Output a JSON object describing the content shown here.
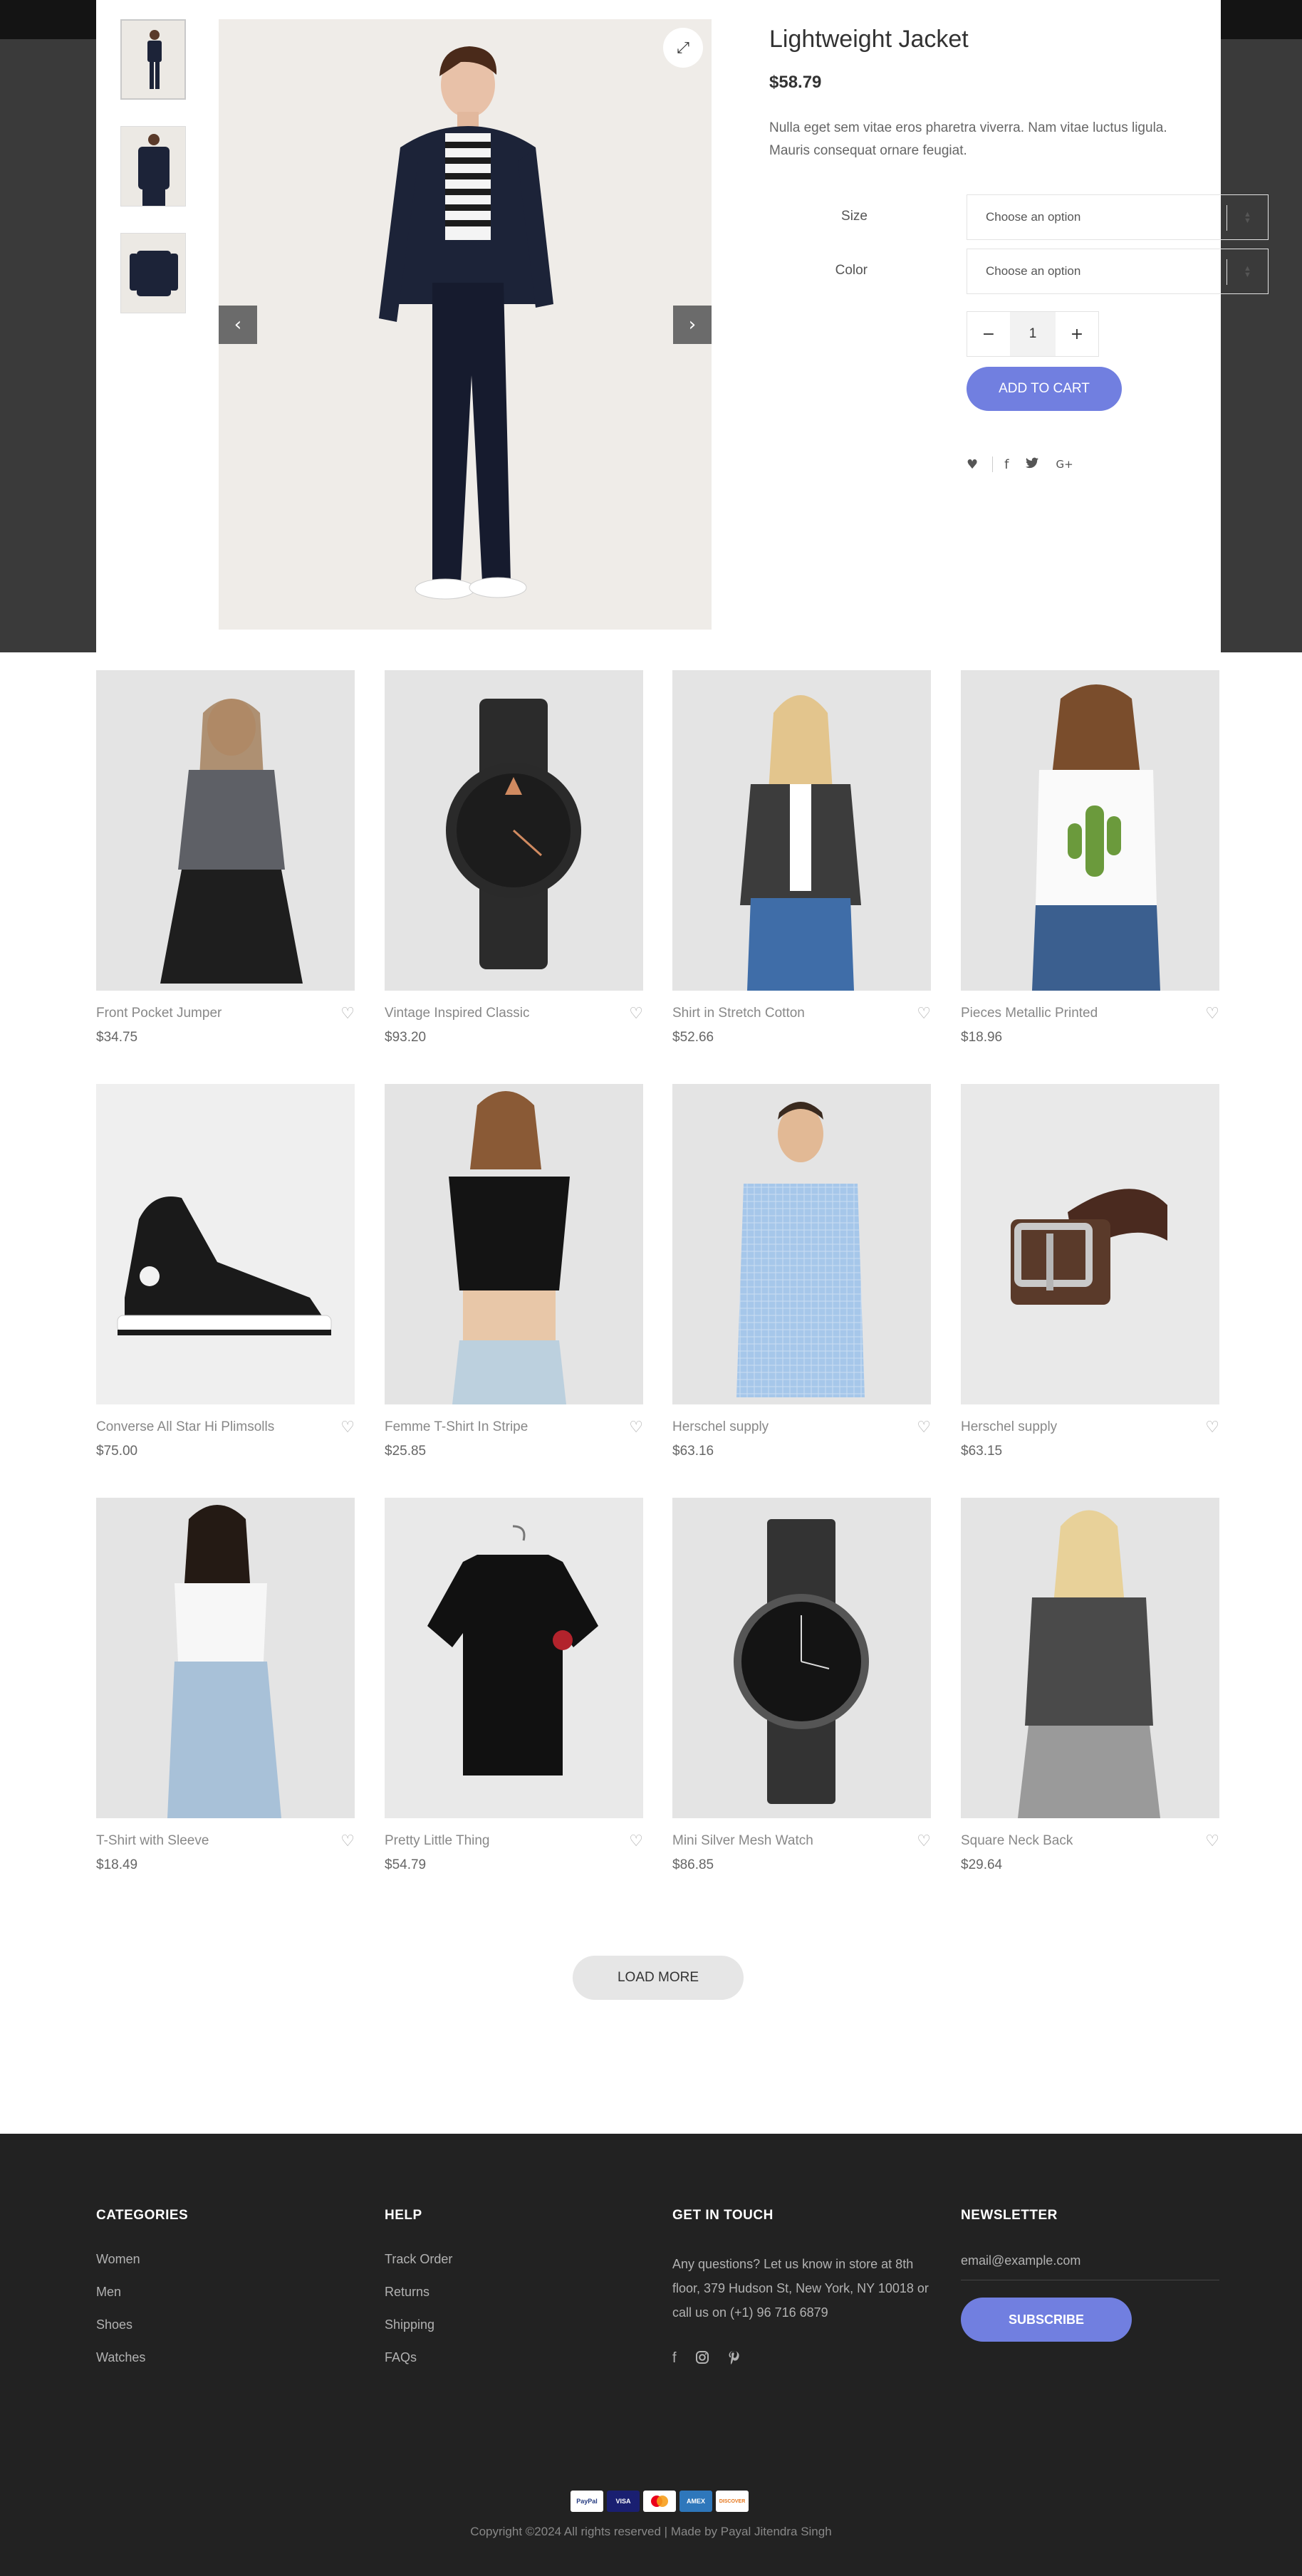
{
  "product": {
    "title": "Lightweight Jacket",
    "price": "$58.79",
    "description": "Nulla eget sem vitae eros pharetra viverra. Nam vitae luctus ligula. Mauris consequat ornare feugiat.",
    "size_label": "Size",
    "color_label": "Color",
    "size_placeholder": "Choose an option",
    "color_placeholder": "Choose an option",
    "quantity": "1",
    "minus": "−",
    "plus": "+",
    "add_to_cart": "ADD TO CART",
    "social": {
      "heart": "♥",
      "facebook": "f",
      "twitter": "🐦",
      "google": "G+"
    },
    "expand_icon": "⤢",
    "prev_icon": "‹",
    "next_icon": "›"
  },
  "grid": [
    {
      "name": "Front Pocket Jumper",
      "price": "$34.75",
      "img": "woman-grey-shirt"
    },
    {
      "name": "Vintage Inspired Classic",
      "price": "$93.20",
      "img": "black-watch"
    },
    {
      "name": "Shirt in Stretch Cotton",
      "price": "$52.66",
      "img": "woman-blazer"
    },
    {
      "name": "Pieces Metallic Printed",
      "price": "$18.96",
      "img": "woman-cactus-tee"
    },
    {
      "name": "Converse All Star Hi Plimsolls",
      "price": "$75.00",
      "img": "converse-shoe"
    },
    {
      "name": "Femme T-Shirt In Stripe",
      "price": "$25.85",
      "img": "woman-black-top"
    },
    {
      "name": "Herschel supply",
      "price": "$63.16",
      "img": "man-check-shirt"
    },
    {
      "name": "Herschel supply",
      "price": "$63.15",
      "img": "leather-belt"
    },
    {
      "name": "T-Shirt with Sleeve",
      "price": "$18.49",
      "img": "woman-white-tee"
    },
    {
      "name": "Pretty Little Thing",
      "price": "$54.79",
      "img": "black-crop-tee"
    },
    {
      "name": "Mini Silver Mesh Watch",
      "price": "$86.85",
      "img": "mesh-watch"
    },
    {
      "name": "Square Neck Back",
      "price": "$29.64",
      "img": "woman-grey-tee"
    }
  ],
  "load_more": "LOAD MORE",
  "footer": {
    "categories": {
      "title": "CATEGORIES",
      "links": [
        "Women",
        "Men",
        "Shoes",
        "Watches"
      ]
    },
    "help": {
      "title": "HELP",
      "links": [
        "Track Order",
        "Returns",
        "Shipping",
        "FAQs"
      ]
    },
    "contact": {
      "title": "GET IN TOUCH",
      "text": "Any questions? Let us know in store at 8th floor, 379 Hudson St, New York, NY 10018 or call us on (+1) 96 716 6879"
    },
    "newsletter": {
      "title": "NEWSLETTER",
      "placeholder": "email@example.com",
      "button": "SUBSCRIBE"
    },
    "payments": [
      "PayPal",
      "VISA",
      "MC",
      "AMEX",
      "DISCOVER"
    ],
    "copyright": "Copyright ©2024 All rights reserved | Made by Payal Jitendra Singh"
  },
  "colors": {
    "accent": "#717fe0",
    "footer_bg": "#222222",
    "backdrop": "#3a3a3a"
  }
}
